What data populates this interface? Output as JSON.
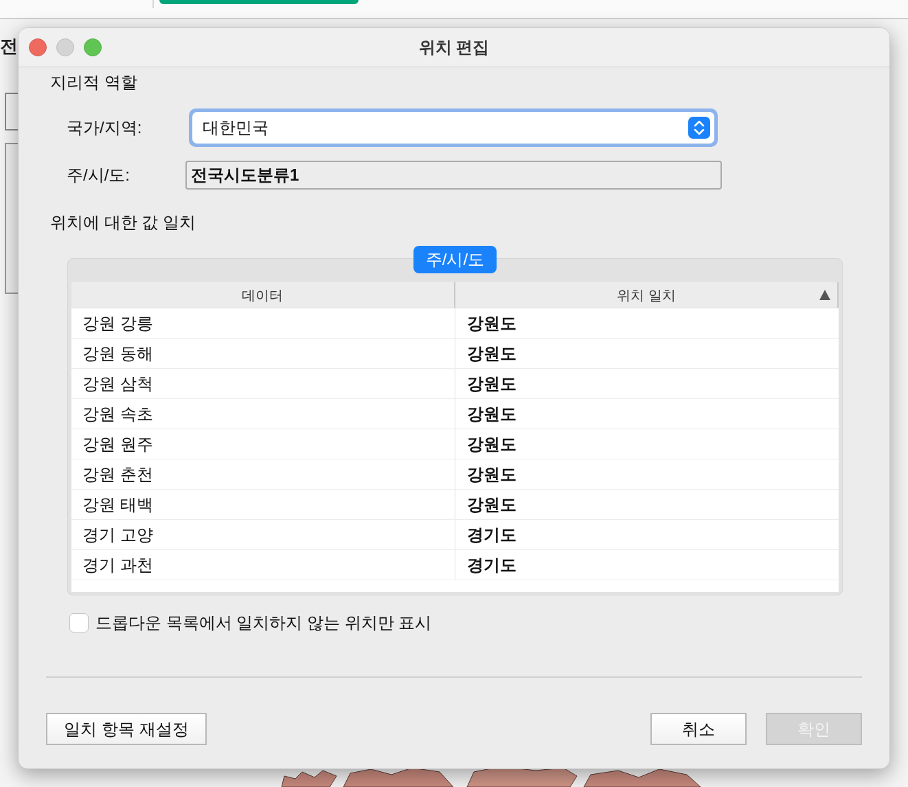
{
  "background": {
    "partial_text": "전"
  },
  "window": {
    "title": "위치 편집"
  },
  "geographic_role": {
    "heading": "지리적 역할",
    "country": {
      "label": "국가/지역:",
      "value": "대한민국"
    },
    "state": {
      "label": "주/시/도:",
      "value": "전국시도분류1"
    }
  },
  "matching": {
    "heading": "위치에 대한 값 일치",
    "tabs": [
      {
        "label": "주/시/도",
        "selected": true
      }
    ],
    "table": {
      "columns": [
        {
          "label": "데이터",
          "sorted": false
        },
        {
          "label": "위치 일치",
          "sorted": true
        }
      ],
      "rows": [
        {
          "data": "강원 강릉",
          "match": "강원도"
        },
        {
          "data": "강원 동해",
          "match": "강원도"
        },
        {
          "data": "강원 삼척",
          "match": "강원도"
        },
        {
          "data": "강원 속초",
          "match": "강원도"
        },
        {
          "data": "강원 원주",
          "match": "강원도"
        },
        {
          "data": "강원 춘천",
          "match": "강원도"
        },
        {
          "data": "강원 태백",
          "match": "강원도"
        },
        {
          "data": "경기 고양",
          "match": "경기도"
        },
        {
          "data": "경기 과천",
          "match": "경기도"
        }
      ]
    }
  },
  "unmatched_only": {
    "label": "드롭다운 목록에서 일치하지 않는 위치만 표시",
    "checked": false
  },
  "buttons": [
    {
      "label": "일치 항목 재설정",
      "disabled": false
    },
    {
      "label": "취소",
      "disabled": false
    },
    {
      "label": "확인",
      "disabled": true
    }
  ]
}
